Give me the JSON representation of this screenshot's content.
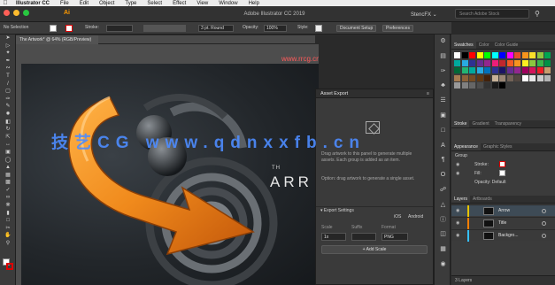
{
  "menubar": {
    "apple": "",
    "items": [
      "Illustrator CC",
      "File",
      "Edit",
      "Object",
      "Type",
      "Select",
      "Effect",
      "View",
      "Window",
      "Help"
    ]
  },
  "appbar": {
    "logo": "Ai",
    "title": "Adobe Illustrator CC 2019",
    "workspace": "StencFX ⌄",
    "search_placeholder": "Search Adobe Stock"
  },
  "controlbar": {
    "selection": "No Selection",
    "stroke_label": "Stroke:",
    "brush": "3 pt. Round",
    "opacity_label": "Opacity:",
    "opacity_value": "100%",
    "style_label": "Style:",
    "doc_setup": "Document Setup",
    "preferences": "Preferences"
  },
  "document": {
    "tab_label": "The Artwork* @ 64% (RGB/Preview)"
  },
  "artwork": {
    "subtitle": "TH",
    "title": "ARR",
    "colors": {
      "arrow": "#f08a1c",
      "arrow_dark": "#c2560a",
      "arrow_light": "#ffb347"
    }
  },
  "watermark": {
    "text": "技艺CG  www.qdnxxfb.cn",
    "top": "www.rrcg.cn"
  },
  "asset_export": {
    "title": "Asset Export",
    "drop_text": "Drag artwork to this panel to generate multiple assets. Each group is added as an item.",
    "option_text": "Option: drag artwork to generate a single asset.",
    "export_settings": "Export Settings",
    "ios": "iOS",
    "android": "Android",
    "col_scale": "Scale",
    "col_suffix": "Suffix",
    "col_format": "Format",
    "scale_value": "1x",
    "suffix_value": "",
    "format_value": "PNG",
    "add_scale": "+ Add Scale"
  },
  "swatches_panel": {
    "tabs": [
      "Swatches",
      "Color",
      "Color Guide"
    ],
    "colors": [
      "#ffffff",
      "#000000",
      "#ff0000",
      "#ffff00",
      "#00ff00",
      "#00ffff",
      "#0000ff",
      "#ff00ff",
      "#e64d2e",
      "#f7941d",
      "#fbe02b",
      "#8dc63f",
      "#00a651",
      "#00a99d",
      "#29abe2",
      "#2e3192",
      "#662d91",
      "#92278f",
      "#ed1e79",
      "#c1272d",
      "#f15a24",
      "#f7931e",
      "#fcee21",
      "#8cc63f",
      "#39b54a",
      "#009245",
      "#006837",
      "#22b573",
      "#00a99d",
      "#29abe2",
      "#0071bc",
      "#2e3192",
      "#1b1464",
      "#662d91",
      "#93278f",
      "#9e005d",
      "#d4145a",
      "#ed1c24",
      "#c69c6d",
      "#a67c52",
      "#8c6239",
      "#754c24",
      "#603813",
      "#42210b",
      "#c7b299",
      "#998675",
      "#736357",
      "#534741",
      "#ffffff",
      "#e6e6e6",
      "#cccccc",
      "#b3b3b3",
      "#999999",
      "#808080",
      "#666666",
      "#4d4d4d",
      "#333333",
      "#1a1a1a",
      "#000000"
    ]
  },
  "stroke_panel": {
    "tabs": [
      "Stroke",
      "Gradient",
      "Transparency"
    ]
  },
  "appearance_panel": {
    "tabs": [
      "Appearance",
      "Graphic Styles"
    ],
    "group": "Group",
    "rows": [
      "Stroke:",
      "Fill:",
      "Opacity: Default"
    ]
  },
  "layers_panel": {
    "tabs": [
      "Layers",
      "Artboards"
    ],
    "layers": [
      "Arrow",
      "Title",
      "Backgro..."
    ],
    "footer": "3 Layers"
  },
  "toolbar": {
    "tools": [
      "selection-tool",
      "direct-select-tool",
      "magic-wand-tool",
      "pen-tool",
      "curvature-tool",
      "type-tool",
      "line-tool",
      "rectangle-tool",
      "paintbrush-tool",
      "pencil-tool",
      "shaper-tool",
      "eraser-tool",
      "rotate-tool",
      "scale-tool",
      "width-tool",
      "free-transform-tool",
      "shape-builder-tool",
      "perspective-tool",
      "mesh-tool",
      "gradient-tool",
      "eyedropper-tool",
      "blend-tool",
      "symbol-sprayer-tool",
      "graph-tool",
      "artboard-tool",
      "slice-tool",
      "hand-tool",
      "zoom-tool"
    ]
  }
}
